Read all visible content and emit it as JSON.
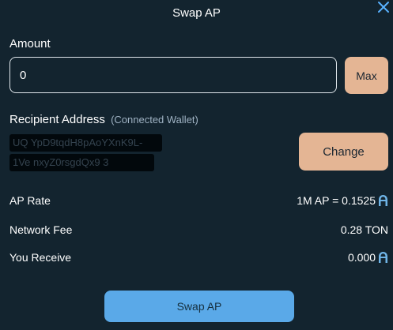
{
  "modal": {
    "title": "Swap AP",
    "close_icon": "close-icon"
  },
  "amount": {
    "label": "Amount",
    "value": "0",
    "max_label": "Max"
  },
  "recipient": {
    "label": "Recipient Address",
    "sublabel": "(Connected Wallet)",
    "address_line1": "UQ  YpD9tqdH8pAoYXnK9L-",
    "address_line2": "1Ve  nxyZ0rsgdQx9  3",
    "change_label": "Change"
  },
  "details": {
    "ap_rate_label": "AP Rate",
    "ap_rate_value": "1M AP = 0.1525",
    "network_fee_label": "Network Fee",
    "network_fee_value": "0.28 TON",
    "you_receive_label": "You Receive",
    "you_receive_value": "0.000"
  },
  "swap_button_label": "Swap AP",
  "colors": {
    "background": "#13242f",
    "accent_button": "#e4b594",
    "primary_button": "#5aa9e8",
    "close_icon": "#58b2ff",
    "token_icon": "#6fb4e6"
  }
}
